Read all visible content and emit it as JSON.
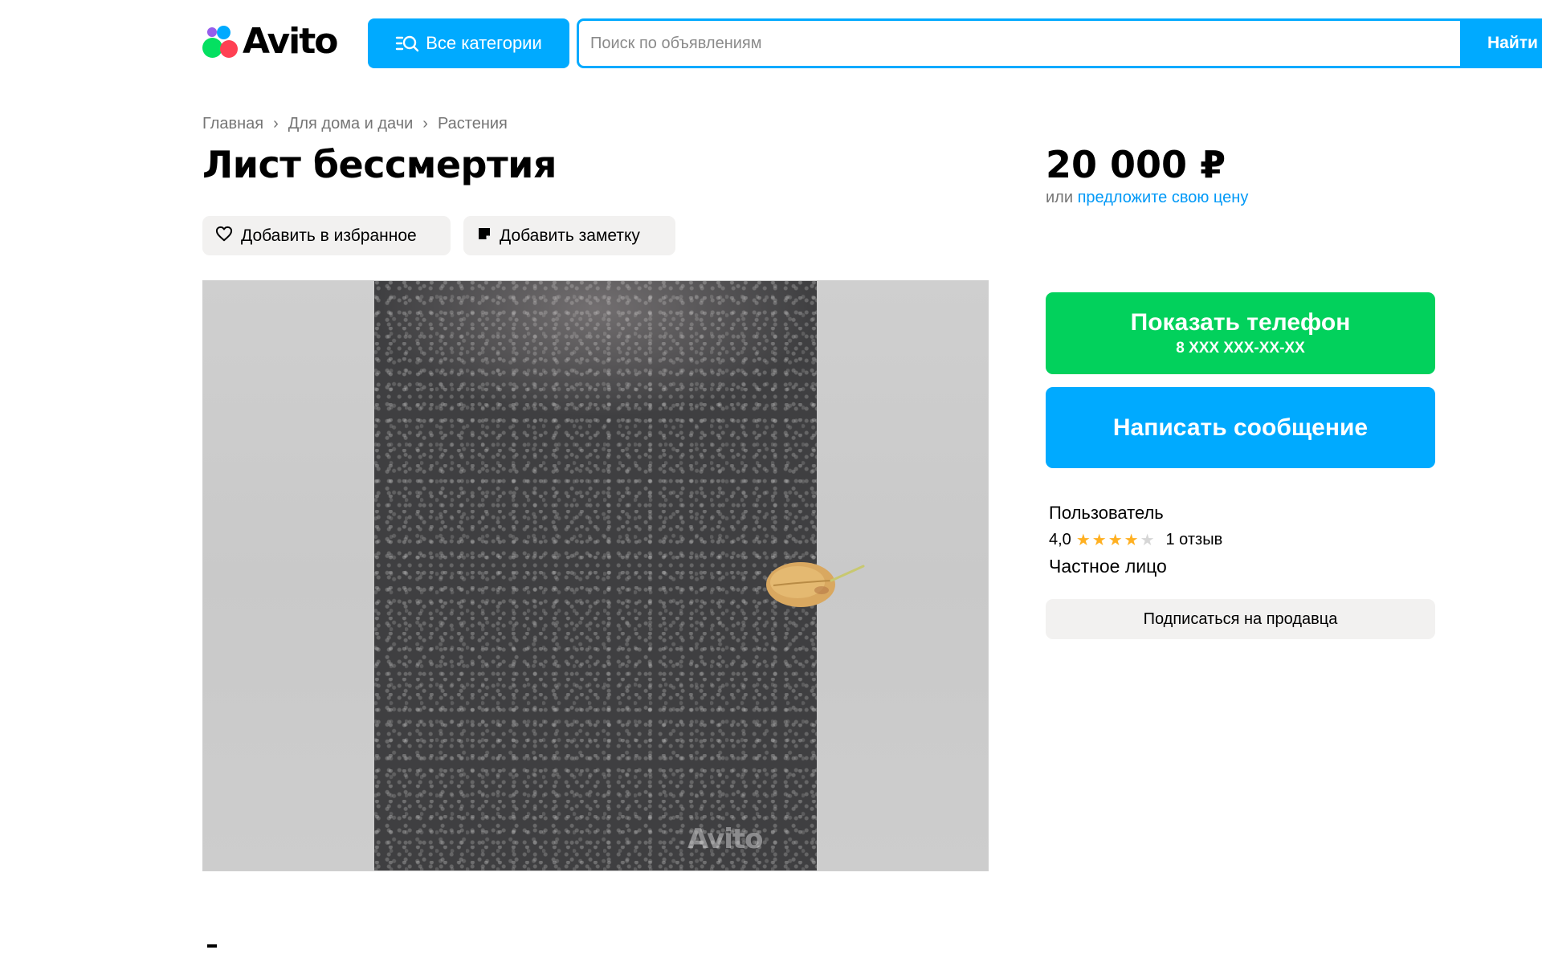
{
  "header": {
    "logo_text": "Avito",
    "categories_button": "Все категории",
    "search_placeholder": "Поиск по объявлениям",
    "search_button": "Найти"
  },
  "breadcrumb": [
    "Главная",
    "Для дома и дачи",
    "Растения"
  ],
  "listing": {
    "title": "Лист бессмертия",
    "favorite_button": "Добавить в избранное",
    "note_button": "Добавить заметку",
    "photo_watermark": "Avito"
  },
  "price": {
    "value": "20 000 ₽",
    "offer_prefix": "или",
    "offer_link": "предложите свою цену"
  },
  "contact": {
    "show_phone_label": "Показать телефон",
    "phone_masked": "8 XXX XXX-XX-XX",
    "message_button": "Написать сообщение"
  },
  "seller": {
    "name": "Пользователь",
    "rating": "4,0",
    "rating_stars": 4,
    "rating_max": 5,
    "reviews": "1 отзыв",
    "type": "Частное лицо",
    "subscribe_button": "Подписаться на продавца"
  },
  "colors": {
    "accent_blue": "#00aaff",
    "phone_green": "#02d15c",
    "star_yellow": "#ffb021",
    "link_blue": "#0099f7"
  }
}
